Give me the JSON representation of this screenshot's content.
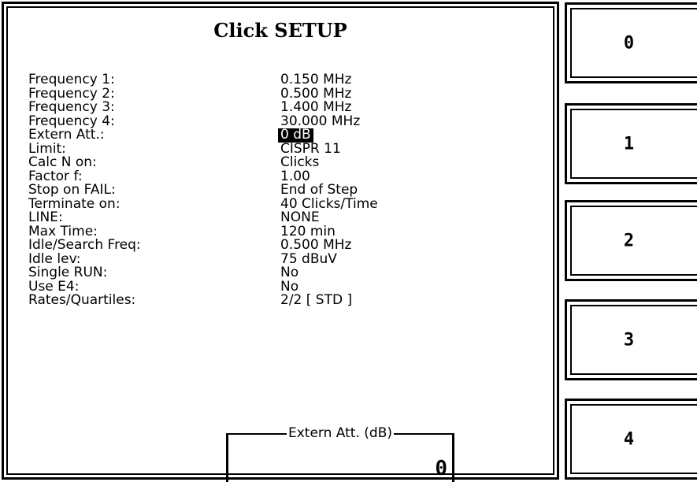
{
  "title": "Click SETUP",
  "settings": [
    {
      "label": "Frequency 1:",
      "value": "0.150  MHz"
    },
    {
      "label": "Frequency 2:",
      "value": "0.500  MHz"
    },
    {
      "label": "Frequency 3:",
      "value": "1.400  MHz"
    },
    {
      "label": "Frequency 4:",
      "value": "30.000  MHz"
    },
    {
      "label": "Extern Att.:",
      "value": "0  dB"
    },
    {
      "label": "Limit:",
      "value": "CISPR  11"
    },
    {
      "label": "Calc N on:",
      "value": "Clicks"
    },
    {
      "label": "Factor f:",
      "value": "1.00"
    },
    {
      "label": "Stop on FAIL:",
      "value": "End  of  Step"
    },
    {
      "label": "Terminate on:",
      "value": "40  Clicks/Time"
    },
    {
      "label": "LINE:",
      "value": "NONE"
    },
    {
      "label": "Max Time:",
      "value": "120  min"
    },
    {
      "label": "Idle/Search Freq:",
      "value": "0.500  MHz"
    },
    {
      "label": "Idle lev:",
      "value": "75  dBuV"
    },
    {
      "label": "Single RUN:",
      "value": "No"
    },
    {
      "label": "Use E4:",
      "value": "No"
    },
    {
      "label": "Rates/Quartiles:",
      "value": "2/2 [ STD ]"
    }
  ],
  "entry": {
    "label": "Extern Att. (dB)",
    "value": "0"
  },
  "softkeys": [
    {
      "label": "0"
    },
    {
      "label": "1"
    },
    {
      "label": "2"
    },
    {
      "label": "3"
    },
    {
      "label": "4"
    }
  ]
}
